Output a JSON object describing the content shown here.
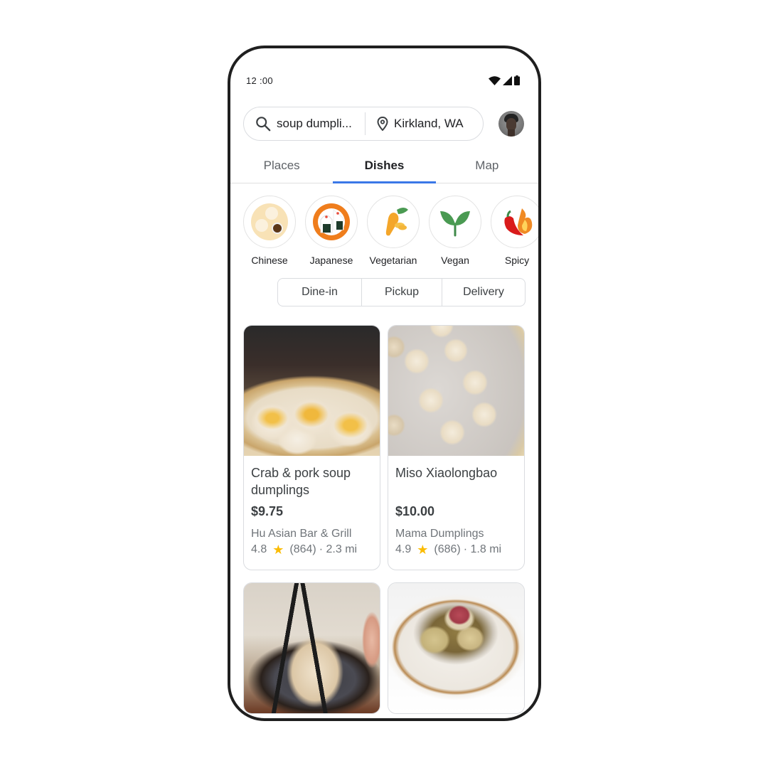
{
  "status_bar": {
    "time": "12 :00",
    "icons": [
      "wifi-icon",
      "signal-icon",
      "battery-icon"
    ]
  },
  "search": {
    "query": "soup dumpli...",
    "location": "Kirkland, WA",
    "search_icon": "search-icon",
    "location_icon": "location-pin-icon"
  },
  "tabs": [
    {
      "label": "Places",
      "active": false
    },
    {
      "label": "Dishes",
      "active": true
    },
    {
      "label": "Map",
      "active": false
    }
  ],
  "accent_color": "#3b78e7",
  "categories": [
    {
      "label": "Chinese",
      "icon": "dim-sum-icon"
    },
    {
      "label": "Japanese",
      "icon": "onigiri-icon"
    },
    {
      "label": "Vegetarian",
      "icon": "carrot-icon"
    },
    {
      "label": "Vegan",
      "icon": "sprout-icon"
    },
    {
      "label": "Spicy",
      "icon": "chili-fire-icon"
    }
  ],
  "service_options": [
    "Dine-in",
    "Pickup",
    "Delivery"
  ],
  "dishes": [
    {
      "name": "Crab & pork soup dumplings",
      "price": "$9.75",
      "restaurant": "Hu Asian Bar & Grill",
      "rating": "4.8",
      "reviews": "(864)",
      "distance": "· 2.3 mi",
      "image": "soup dumplings in bamboo steamer with crab roe"
    },
    {
      "name": "Miso Xiaolongbao",
      "price": "$10.00",
      "restaurant": "Mama Dumplings",
      "rating": "4.9",
      "reviews": "(686)",
      "distance": "· 1.8 mi",
      "image": "xiaolongbao on parchment in steamer"
    },
    {
      "image": "dumpling held with chopsticks over dipping bowl"
    },
    {
      "image": "wontons in clear soup bowl"
    }
  ]
}
